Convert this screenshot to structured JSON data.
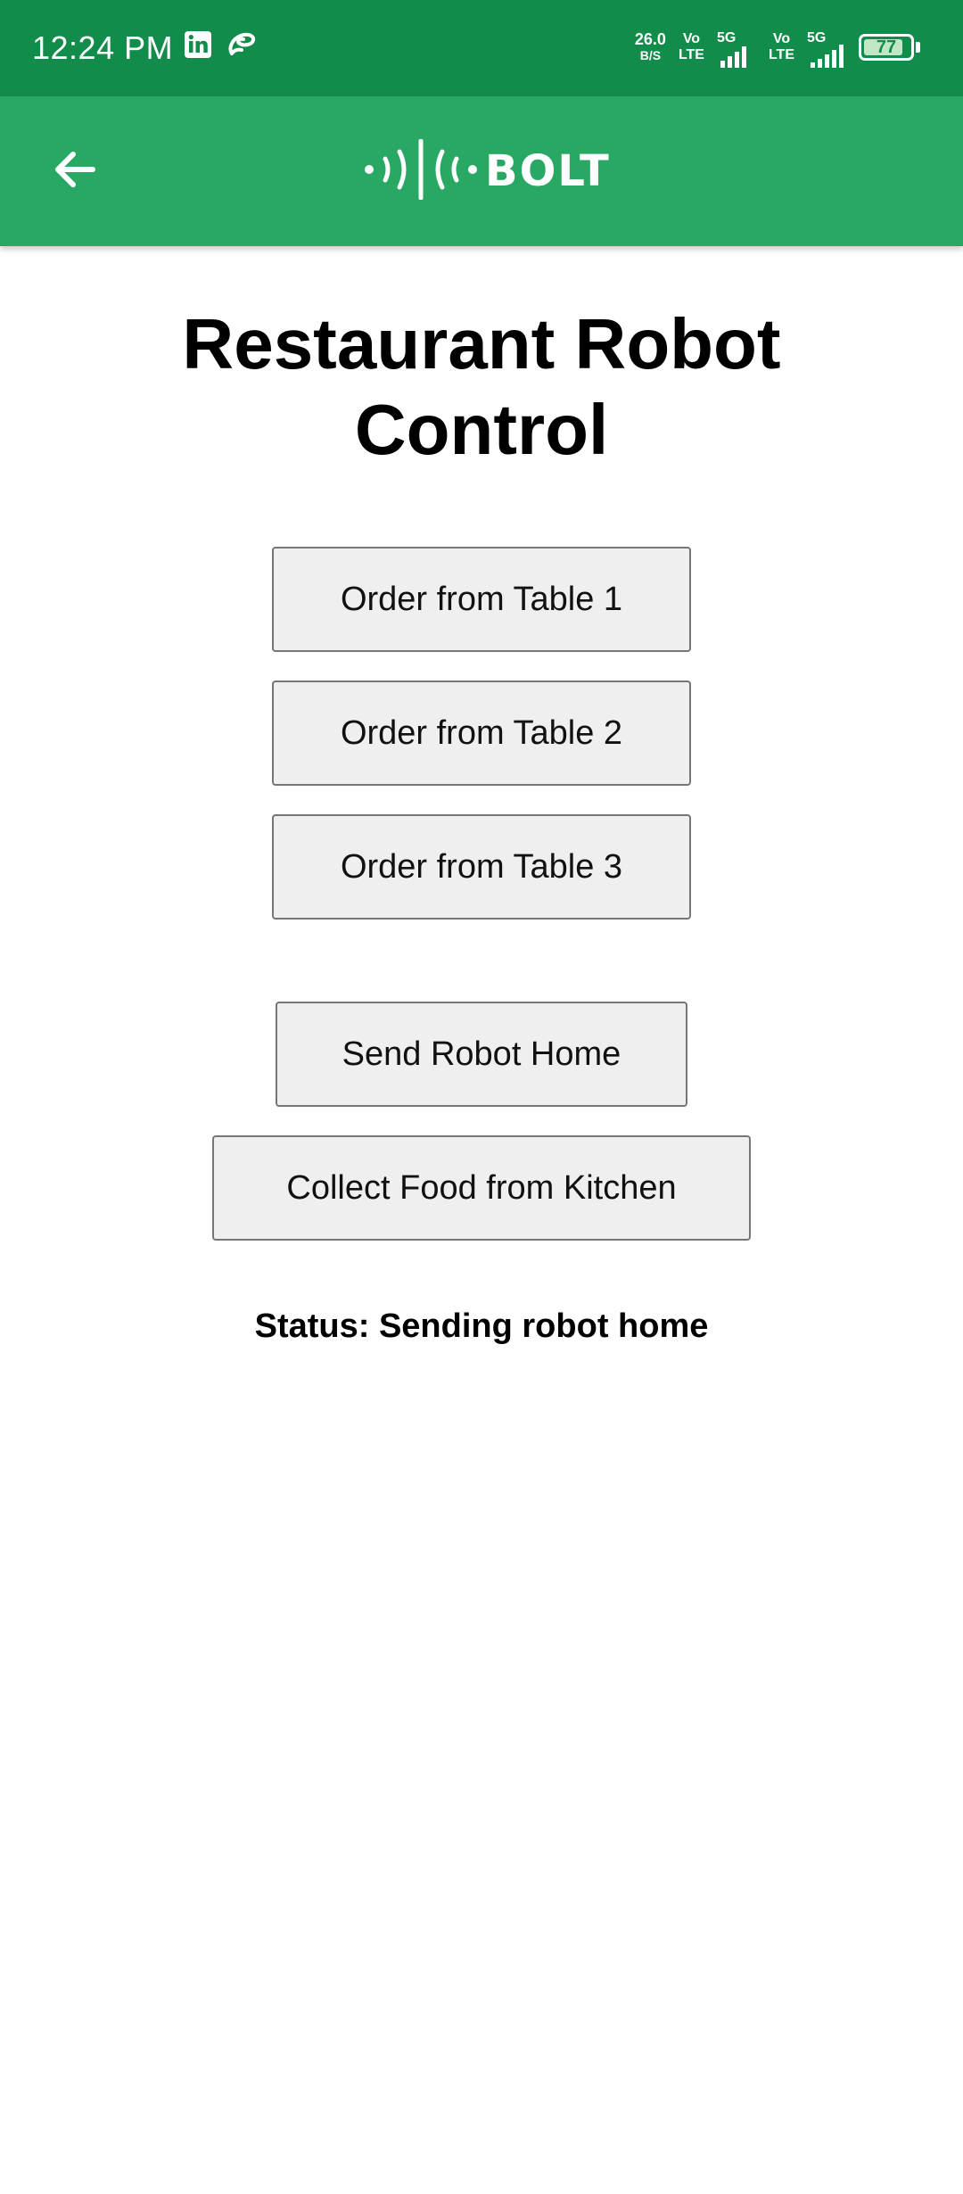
{
  "status_bar": {
    "time": "12:24 PM",
    "left_icons": [
      "linkedin-icon",
      "airtel-icon"
    ],
    "net_speed_value": "26.0",
    "net_speed_unit": "B/S",
    "sim1_volte_top": "Vo",
    "sim1_volte_bottom": "LTE",
    "sim1_network": "5G",
    "sim2_volte_top": "Vo",
    "sim2_volte_bottom": "LTE",
    "sim2_network": "5G",
    "battery_level": "77",
    "colors": {
      "bar_bg": "#128c4a"
    }
  },
  "app_bar": {
    "back_icon": "arrow-left-icon",
    "logo_icon": "bolt-signal-icon",
    "logo_text": "BOLT",
    "colors": {
      "bg": "#28a862"
    }
  },
  "main": {
    "title": "Restaurant Robot Control",
    "buttons": {
      "table1": "Order from Table 1",
      "table2": "Order from Table 2",
      "table3": "Order from Table 3",
      "home": "Send Robot Home",
      "kitchen": "Collect Food from Kitchen"
    },
    "status": "Status: Sending robot home"
  }
}
